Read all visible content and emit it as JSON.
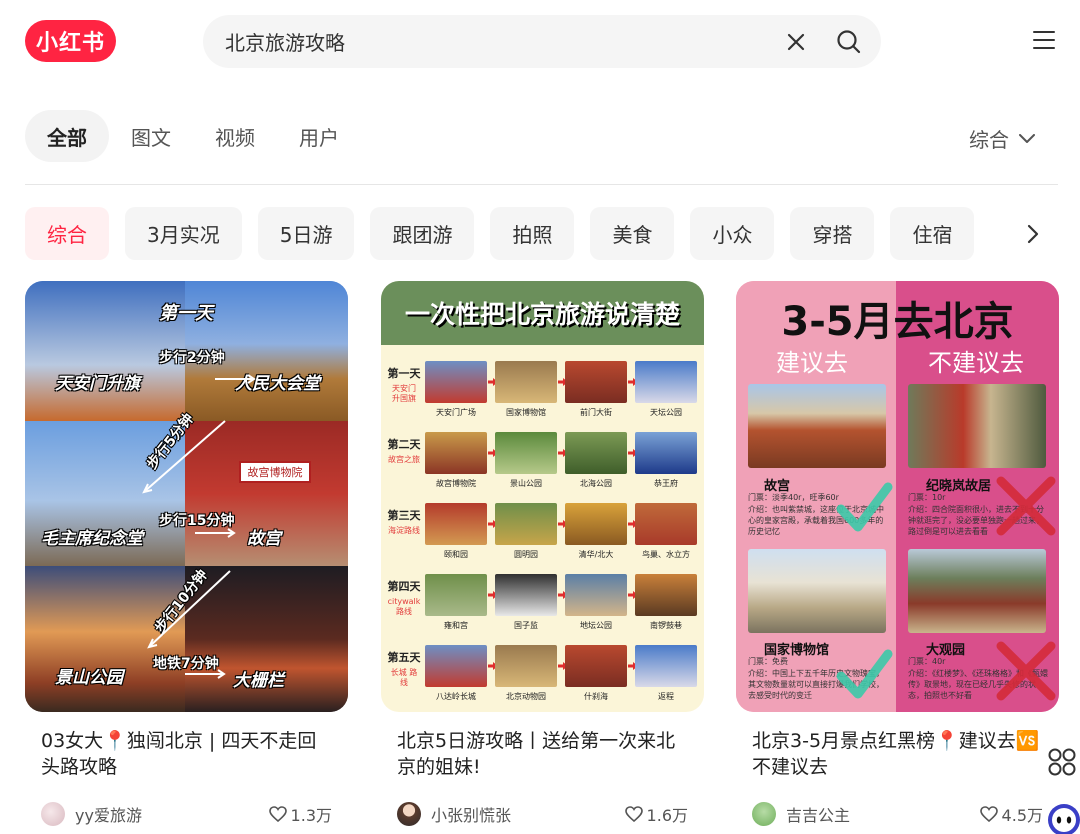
{
  "header": {
    "logo_text": "小红书",
    "search_value": "北京旅游攻略"
  },
  "tabs": [
    {
      "label": "全部"
    },
    {
      "label": "图文"
    },
    {
      "label": "视频"
    },
    {
      "label": "用户"
    }
  ],
  "sort_label": "综合",
  "chips": [
    {
      "label": "综合"
    },
    {
      "label": "3月实况"
    },
    {
      "label": "5日游"
    },
    {
      "label": "跟团游"
    },
    {
      "label": "拍照"
    },
    {
      "label": "美食"
    },
    {
      "label": "小众"
    },
    {
      "label": "穿搭"
    },
    {
      "label": "住宿"
    }
  ],
  "cards": [
    {
      "title": "03女大📍独闯北京 | 四天不走回头路攻略",
      "author": "yy爱旅游",
      "likes": "1.3万",
      "cover": {
        "day_label": "第一天",
        "places": [
          "天安门升旗",
          "人民大会堂",
          "毛主席纪念堂",
          "故宫",
          "景山公园",
          "大栅栏"
        ],
        "walks": [
          "步行2分钟",
          "步行5分钟",
          "步行15分钟",
          "步行10分钟",
          "地铁7分钟"
        ],
        "sign": "故宫博物院"
      }
    },
    {
      "title": "北京5日游攻略丨送给第一次来北京的姐妹!",
      "author": "小张别慌张",
      "likes": "1.6万",
      "cover": {
        "banner": "一次性把北京旅游说清楚",
        "days": [
          {
            "label": "第一天",
            "sub": "天安门 升国旗",
            "spots": [
              "天安门广场",
              "国家博物馆",
              "前门大街",
              "天坛公园"
            ]
          },
          {
            "label": "第二天",
            "sub": "故宫之旅",
            "spots": [
              "故宫博物院",
              "景山公园",
              "北海公园",
              "恭王府"
            ]
          },
          {
            "label": "第三天",
            "sub": "海淀路线",
            "spots": [
              "颐和园",
              "圆明园",
              "清华/北大",
              "鸟巢、水立方"
            ]
          },
          {
            "label": "第四天",
            "sub": "citywalk 路线",
            "spots": [
              "雍和宫",
              "国子监",
              "地坛公园",
              "南锣鼓巷"
            ]
          },
          {
            "label": "第五天",
            "sub": "长城 路线",
            "spots": [
              "八达岭长城",
              "北京动物园",
              "什刹海",
              "返程"
            ]
          }
        ]
      }
    },
    {
      "title": "北京3-5月景点红黑榜📍建议去🆚不建议去",
      "author": "吉吉公主",
      "likes": "4.5万",
      "cover": {
        "headline": "3-5月去北京",
        "left_label": "建议去",
        "right_label": "不建议去",
        "spots": [
          {
            "name": "故宫",
            "ticket": "门票：淡季40r，旺季60r",
            "intro": "介绍：也叫紫禁城，这座位于北京城中心的皇家宫殿，承载着我国600多年的历史记忆"
          },
          {
            "name": "纪晓岚故居",
            "ticket": "门票：10r",
            "intro": "介绍：四合院面积很小，进去不到十分钟就逛完了，没必要单独跑一趟过来，路过倒是可以进去看看"
          },
          {
            "name": "国家博物馆",
            "ticket": "门票：免费",
            "intro": "介绍：中国上下五千年历史文物瑰宝，其文物数量就可以直接打爆我们学校，去感受时代的变迁"
          },
          {
            "name": "大观园",
            "ticket": "门票：40r",
            "intro": "介绍：《红楼梦》、《还珠格格》和《甄嬛传》取景地，现在已经几乎失修的状态，拍照也不好看"
          }
        ]
      }
    }
  ],
  "colors": {
    "brand": "#ff2442",
    "chip_active_bg": "#fff0f1"
  },
  "icons": [
    "logo",
    "clear-icon",
    "search-icon",
    "menu-icon",
    "chevron-down-icon",
    "chevron-right-icon",
    "heart-icon",
    "grid-icon",
    "bot-icon"
  ]
}
